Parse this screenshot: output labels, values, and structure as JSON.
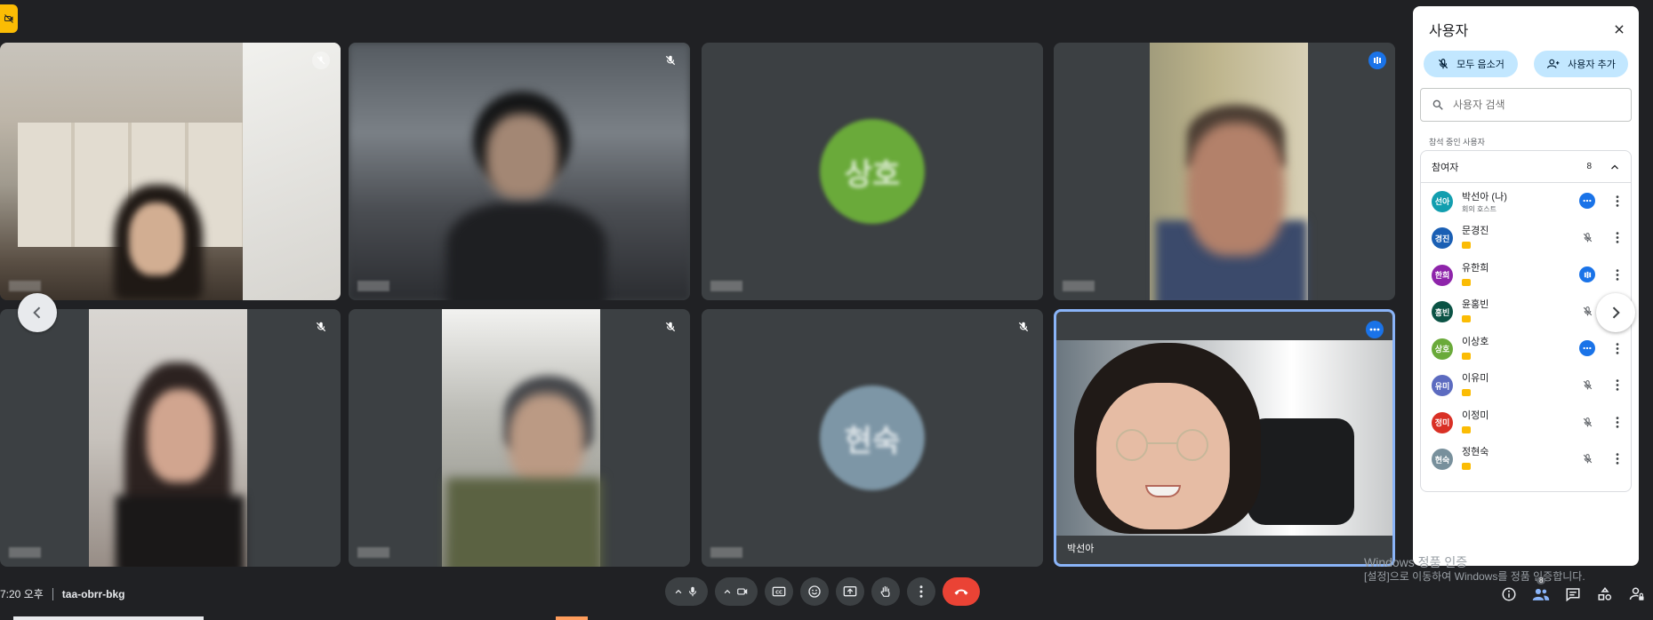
{
  "meeting": {
    "time": "7:20 오후",
    "code": "taa-obrr-bkg"
  },
  "tiles": [
    {
      "id": "t1",
      "name": "",
      "status": "muted"
    },
    {
      "id": "t2",
      "name": "",
      "status": "muted"
    },
    {
      "id": "t3",
      "name": "",
      "status": "none",
      "avatar_text": "상호",
      "avatar_color": "#6aaa3a"
    },
    {
      "id": "t4",
      "name": "",
      "status": "speaking-bars"
    },
    {
      "id": "t5",
      "name": "",
      "status": "muted"
    },
    {
      "id": "t6",
      "name": "",
      "status": "muted"
    },
    {
      "id": "t7",
      "name": "",
      "status": "muted",
      "avatar_text": "현숙",
      "avatar_color": "#7d96a6"
    },
    {
      "id": "t8",
      "name": "박선아",
      "status": "more"
    }
  ],
  "panel": {
    "title": "사용자",
    "mute_all": "모두 음소거",
    "add_people": "사용자 추가",
    "search_placeholder": "사용자 검색",
    "section": "참석 중인 사용자",
    "group_label": "참여자",
    "group_count": "8",
    "people": [
      {
        "initials": "선아",
        "name": "박선아 (나)",
        "sub": "회의 호스트",
        "color": "#129eaf",
        "status": "more"
      },
      {
        "initials": "경진",
        "name": "문경진",
        "sub": "",
        "color": "#1a5fb4",
        "status": "muted"
      },
      {
        "initials": "한희",
        "name": "유한희",
        "sub": "",
        "color": "#8e24aa",
        "status": "bars"
      },
      {
        "initials": "홍빈",
        "name": "윤홍빈",
        "sub": "",
        "color": "#0b5345",
        "status": "muted"
      },
      {
        "initials": "상호",
        "name": "이상호",
        "sub": "",
        "color": "#6aaa3a",
        "status": "more"
      },
      {
        "initials": "유미",
        "name": "이유미",
        "sub": "",
        "color": "#5c6bc0",
        "status": "muted"
      },
      {
        "initials": "정미",
        "name": "이정미",
        "sub": "",
        "color": "#d93025",
        "status": "muted"
      },
      {
        "initials": "현숙",
        "name": "정현숙",
        "sub": "",
        "color": "#78909c",
        "status": "muted"
      }
    ]
  },
  "watermark": {
    "line1": "Windows 정품 인증",
    "line2": "[설정]으로 이동하여 Windows를 정품 인증합니다."
  },
  "people_badge_count": "8",
  "icons": {
    "mic": "microphone-icon",
    "camera": "camera-icon",
    "captions": "captions-icon",
    "emoji": "emoji-icon",
    "present": "present-screen-icon",
    "hand": "raise-hand-icon",
    "more": "more-vert-icon",
    "end": "end-call-icon"
  }
}
